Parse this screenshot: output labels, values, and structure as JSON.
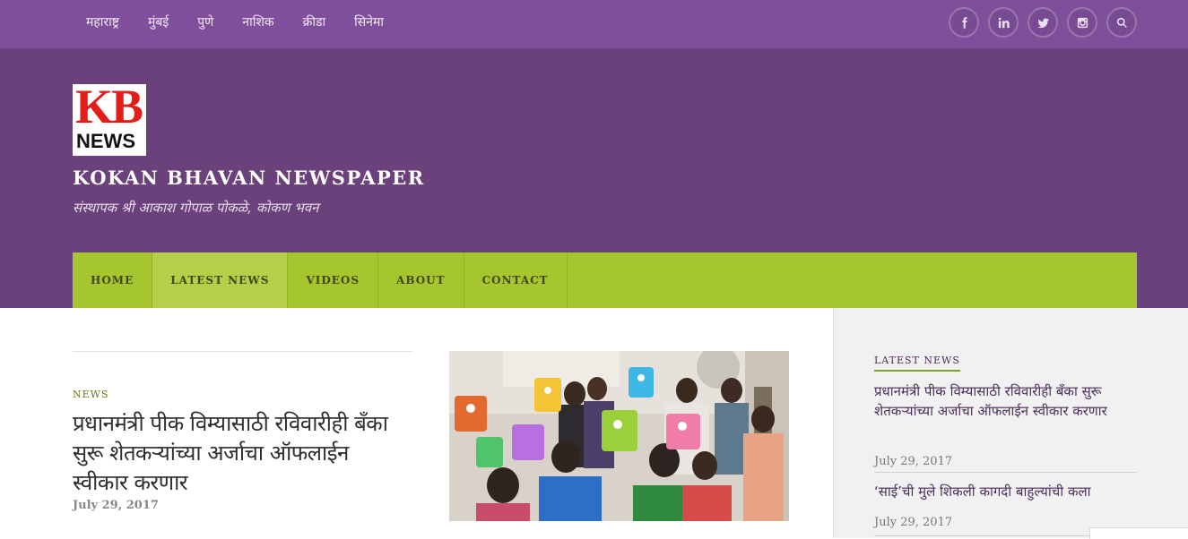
{
  "topnav": {
    "items": [
      "महाराष्ट्र",
      "मुंबई",
      "पुणे",
      "नाशिक",
      "क्रीडा",
      "सिनेमा"
    ]
  },
  "social": {
    "icons": [
      "facebook-icon",
      "linkedin-icon",
      "twitter-icon",
      "instagram-icon",
      "search-icon"
    ]
  },
  "header": {
    "logo_top": "KB",
    "logo_bottom": "NEWS",
    "site_title": "KOKAN BHAVAN NEWSPAPER",
    "tagline": "संस्थापक श्री आकाश गोपाळ पोकळे, कोकण भवन"
  },
  "mainnav": {
    "items": [
      "HOME",
      "LATEST NEWS",
      "VIDEOS",
      "ABOUT",
      "CONTACT"
    ],
    "active": "LATEST NEWS"
  },
  "article": {
    "category": "NEWS",
    "headline": "प्रधानमंत्री पीक विम्यासाठी रविवारीही बँका सुरू शेतकऱ्यांच्या अर्जाचा ऑफलाईन स्वीकार करणार",
    "date": "July 29, 2017"
  },
  "sidebar": {
    "heading": "LATEST NEWS",
    "items": [
      {
        "title": "प्रधानमंत्री पीक विम्यासाठी रविवारीही बँका सुरू शेतकऱ्यांच्या अर्जाचा ऑफलाईन स्वीकार करणार",
        "date": "July 29, 2017"
      },
      {
        "title": "‘साई’ची मुले शिकली कागदी बाहुल्यांची कला",
        "date": "July 29, 2017"
      }
    ]
  },
  "colors": {
    "topbar": "#7f4f9b",
    "header": "#6a417a",
    "nav": "#a6c630",
    "logo_red": "#e31d1a"
  }
}
